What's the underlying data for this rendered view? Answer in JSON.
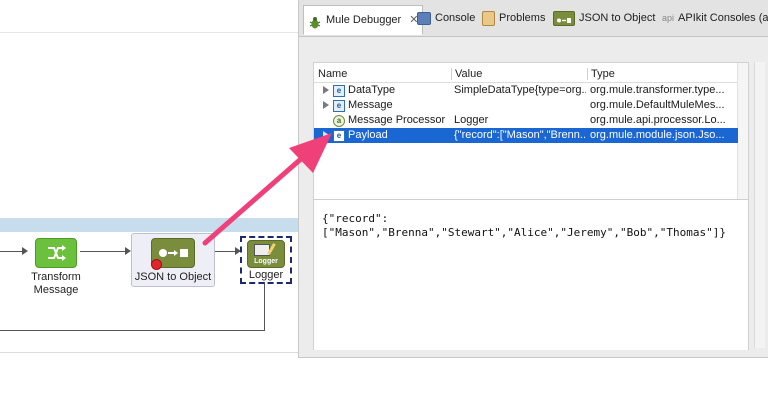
{
  "tabs": [
    {
      "label": "Mule Debugger",
      "icon": "bug-icon",
      "active": true,
      "close": "✕"
    },
    {
      "label": "Console",
      "icon": "console-icon"
    },
    {
      "label": "Problems",
      "icon": "problems-icon"
    },
    {
      "label": "JSON to Object",
      "icon": "json-transformer-icon"
    },
    {
      "label": "APIkit Consoles (ac",
      "icon": "apikit-icon",
      "icon_text": "api"
    }
  ],
  "flow": {
    "nodes": [
      {
        "label_line1": "Transform",
        "label_line2": "Message",
        "icon": "transform-icon"
      },
      {
        "label": "JSON to Object",
        "icon": "json-transformer-icon",
        "breakpoint": true
      },
      {
        "label": "Logger",
        "icon": "logger-icon",
        "icon_text": "Logger"
      }
    ]
  },
  "debugger": {
    "columns": {
      "name": "Name",
      "value": "Value",
      "type": "Type"
    },
    "rows": [
      {
        "name": "DataType",
        "value": "SimpleDataType{type=org...",
        "type": "org.mule.transformer.type...",
        "badge": "e",
        "expandable": true,
        "selected": false
      },
      {
        "name": "Message",
        "value": "",
        "type": "org.mule.DefaultMuleMes...",
        "badge": "e",
        "expandable": true,
        "selected": false
      },
      {
        "name": "Message Processor",
        "value": "Logger",
        "type": "org.mule.api.processor.Lo...",
        "badge": "a",
        "expandable": false,
        "selected": false
      },
      {
        "name": "Payload",
        "value": "{\"record\":[\"Mason\",\"Brenn...",
        "type": "org.mule.module.json.Jso...",
        "badge": "e",
        "expandable": true,
        "selected": true
      }
    ],
    "detail_lines": [
      "{\"record\":",
      "[\"Mason\",\"Brenna\",\"Stewart\",\"Alice\",\"Jeremy\",\"Bob\",\"Thomas\"]}"
    ]
  },
  "colors": {
    "selection": "#1a66d2",
    "annotation_arrow": "#f0407a",
    "breakpoint": "#e0262d",
    "transform_green": "#6cc13c",
    "transformer_olive": "#7a8d3c"
  }
}
